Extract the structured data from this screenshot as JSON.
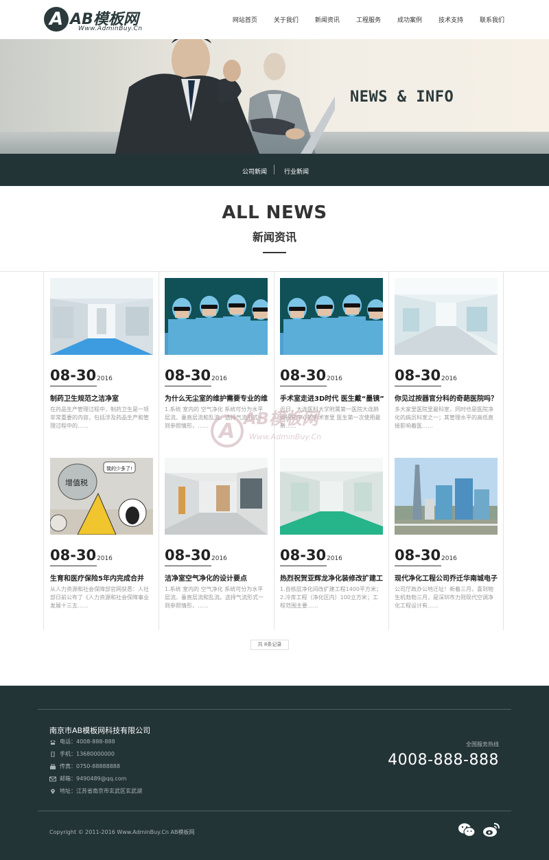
{
  "logo": {
    "title": "AB模板网",
    "subtitle": "Www.AdminBuy.Cn",
    "badge_letter": "A"
  },
  "nav": [
    "网站首页",
    "关于我们",
    "新闻资讯",
    "工程服务",
    "成功案例",
    "技术支持",
    "联系我们"
  ],
  "banner": {
    "title": "NEWS & INFO"
  },
  "subnav": [
    "公司新闻",
    "行业新闻"
  ],
  "section": {
    "title_en": "ALL NEWS",
    "title_cn": "新闻资讯"
  },
  "news": [
    {
      "date": "08-30",
      "year": "2016",
      "title": "制药卫生规范之洁净室",
      "desc": "在药品生产管理过程中，制药卫生是一项非常重要的内容，包括涉及药品生产和管理过程中的……",
      "image": "cleanroom-corridor"
    },
    {
      "date": "08-30",
      "year": "2016",
      "title": "为什么无尘室的维护需要专业的维",
      "desc": "1.系统 室内的 空气净化 系统可分为水平层流、垂直层流和乱流。选择气流形式一则参照情形，……",
      "image": "surgeons"
    },
    {
      "date": "08-30",
      "year": "2016",
      "title": "手术室走进3D时代 医生戴“墨镜”",
      "desc": "近日，大连医科大学附属第一医院大连肺癌研究中心的手术室里 医生第一次使用最新……",
      "image": "surgeons"
    },
    {
      "date": "08-30",
      "year": "2016",
      "title": "你见过按器官分科的奇葩医院吗？",
      "desc": "多大家里医院里最科室，同时也是医院净化的病员科室之一；其管理水平的高低直接影响着医……",
      "image": "hospital-hall"
    },
    {
      "date": "08-30",
      "year": "2016",
      "title": "生育和医疗保险5年内完成合并",
      "desc": "从人力资源和社会保障部官网获悉：人社部日前公布了《人力资源和社会保障事业发展十三五……",
      "image": "cartoon-meeting"
    },
    {
      "date": "08-30",
      "year": "2016",
      "title": "洁净室空气净化的设计要点",
      "desc": "1.系统 室内的 空气净化 系统可分为水平层流、垂直层流和乱流。选择气流形式一则参照情形，……",
      "image": "cleanroom-doors"
    },
    {
      "date": "08-30",
      "year": "2016",
      "title": "热烈祝贺亚辉龙净化装修改扩建工",
      "desc": "1.自核层净化间改扩建工程1400平方米；2.冷库工程（净化区内）100立方米；工程范围主要……",
      "image": "green-corridor"
    },
    {
      "date": "08-30",
      "year": "2016",
      "title": "现代净化工程公司乔迁华南城电子",
      "desc": "公司厅政办公地迁址！新着三月，喜到物生机勃勃三月，是深圳市力则现代空调净化工程设计有……",
      "image": "city-skyline"
    }
  ],
  "pager": "共 8条记录",
  "watermark": {
    "title": "AB模板网",
    "url": "Www.AdminBuy.Cn"
  },
  "footer": {
    "company": "南京市AB模板网科技有限公司",
    "contacts": [
      {
        "icon": "phone-icon",
        "text": "电话：4008-888-888"
      },
      {
        "icon": "mobile-icon",
        "text": "手机：13680000000"
      },
      {
        "icon": "fax-icon",
        "text": "传真：0750-88888888"
      },
      {
        "icon": "mail-icon",
        "text": "邮箱：9490489@qq.com"
      },
      {
        "icon": "location-icon",
        "text": "地址：江苏省南京市玄武区玄武湖"
      }
    ],
    "hotline_label": "全国服务热线",
    "hotline": "4008-888-888",
    "copyright": "Copyright © 2011-2016 Www.AdminBuy.Cn AB模板网"
  },
  "colors": {
    "dark": "#233437",
    "accent": "#2b3a3c"
  }
}
